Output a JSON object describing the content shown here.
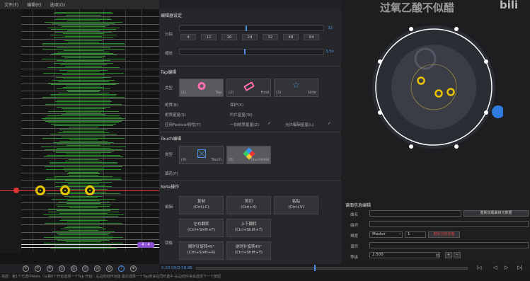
{
  "menu": {
    "items": [
      "文件(F)",
      "编辑(E)",
      "选项(O)"
    ]
  },
  "watermark": "过氧乙酸不似醋",
  "left_panel": {
    "lane_badge": "4 : 4"
  },
  "bottom_icons": [
    "⑤",
    "⑦",
    "⑨",
    "⑮",
    "⑯",
    "⑰",
    "⑱",
    "⑲",
    "7"
  ],
  "editor": {
    "section_title": "编辑器设定",
    "divide_label": "分拍",
    "divide_value": "32",
    "divide_ticks": [
      "4",
      "12",
      "16",
      "24",
      "32",
      "48",
      "64"
    ],
    "speed_label": "缩放",
    "speed_value": "3.5x"
  },
  "tap": {
    "section_title": "Tap编辑",
    "type_label": "类型",
    "cards": [
      {
        "key": "(1)",
        "name": "Tap"
      },
      {
        "key": "(2)",
        "name": "Hold"
      },
      {
        "key": "(3)",
        "name": "Slide"
      }
    ],
    "checks": [
      "绝赞(B)",
      "保护(X)",
      "绝赞星星(S)",
      "约片星星(W)",
      "应用Festival特性(T)",
      "一拍绝赞星星(Z)",
      "允许编辑星星(L)"
    ]
  },
  "touch": {
    "section_title": "Touch编辑",
    "type_label": "类型",
    "cards": [
      {
        "key": "(4)",
        "name": "Touch"
      },
      {
        "key": "(5)",
        "name": "TouchHold"
      }
    ],
    "checks": [
      "烟花(F)"
    ]
  },
  "note_ops": {
    "section_title": "Note操作",
    "edit_label": "编辑",
    "mirror_label": "镜像",
    "buttons": [
      {
        "title": "复制",
        "shortcut": "(Ctrl+C)"
      },
      {
        "title": "剪切",
        "shortcut": "(Ctrl+X)"
      },
      {
        "title": "粘贴",
        "shortcut": "(Ctrl+V)"
      },
      {
        "title": "左右翻转",
        "shortcut": "(Ctrl+Shift+F)"
      },
      {
        "title": "上下翻转",
        "shortcut": "(Ctrl+Shift+T)"
      },
      {
        "title": "顺时针旋转45°",
        "shortcut": "(Ctrl+Shift+R)"
      },
      {
        "title": "逆时针旋转45°",
        "shortcut": "(Ctrl+Shift+Y)"
      }
    ]
  },
  "chart_info": {
    "section_title": "谱面信息编辑",
    "title_label": "曲名",
    "artist_label": "曲师",
    "diff_label": "难度",
    "designer_label": "谱师",
    "level_label": "等级",
    "reload_btn": "重新加载曲目元数据",
    "difficulty_value": "Master",
    "level_value": "1",
    "delete_btn": "删除当前谱面",
    "bpm_value": "2.500",
    "bpm_unit": "秒"
  },
  "timeline": {
    "time": "0:20.09/2:58.85"
  },
  "status": "完成：第1个已选中Note（从第0个开始选择一个Tap 开始）左边的动作功能 最近选择一个Tap将会在同时选中 右边动作将会选择下一个按钮"
}
